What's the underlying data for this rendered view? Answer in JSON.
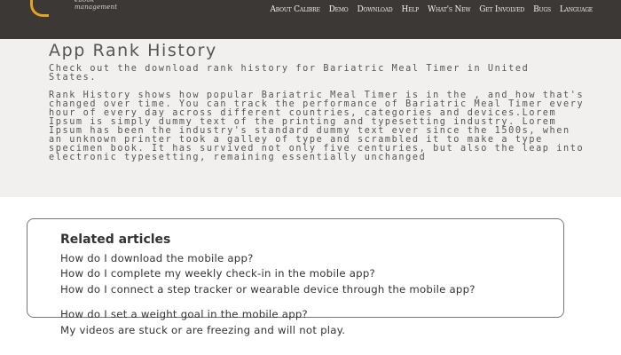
{
  "nav": {
    "items": [
      "About Calibre",
      "Demo",
      "Download",
      "Help",
      "What's New",
      "Get Involved",
      "Bugs",
      "Language"
    ]
  },
  "header": {
    "title": "App Rank History",
    "subtitle": "Check out the download rank history for Bariatric Meal Timer in United States.",
    "body": "Rank History shows how popular Bariatric Meal Timer is in the , and how that's changed over time. You can track the performance of Bariatric Meal Timer every hour of every day across different countries, categories and devices.Lorem Ipsum is simply dummy text of the printing and typesetting industry. Lorem Ipsum has been the industry's standard dummy text ever since the 1500s, when an unknown printer took a galley of type and scrambled it to make a type specimen book. It has survived not only five centuries, but also the leap into electronic typesetting, remaining essentially unchanged"
  },
  "related": {
    "title": "Related articles",
    "links": [
      "How do I download the mobile app?",
      "How do I complete my weekly check-in in the mobile app?",
      "How do I connect a step tracker or wearable device through the mobile app?",
      "How do I set a weight goal in the mobile app?",
      "My videos are stuck or are freezing and will not play."
    ]
  },
  "logo": {
    "tagline": "ebook management"
  },
  "colors": {
    "topbar": "#3b3835",
    "hero": "#f1f0ef",
    "accent": "#e5a322"
  }
}
